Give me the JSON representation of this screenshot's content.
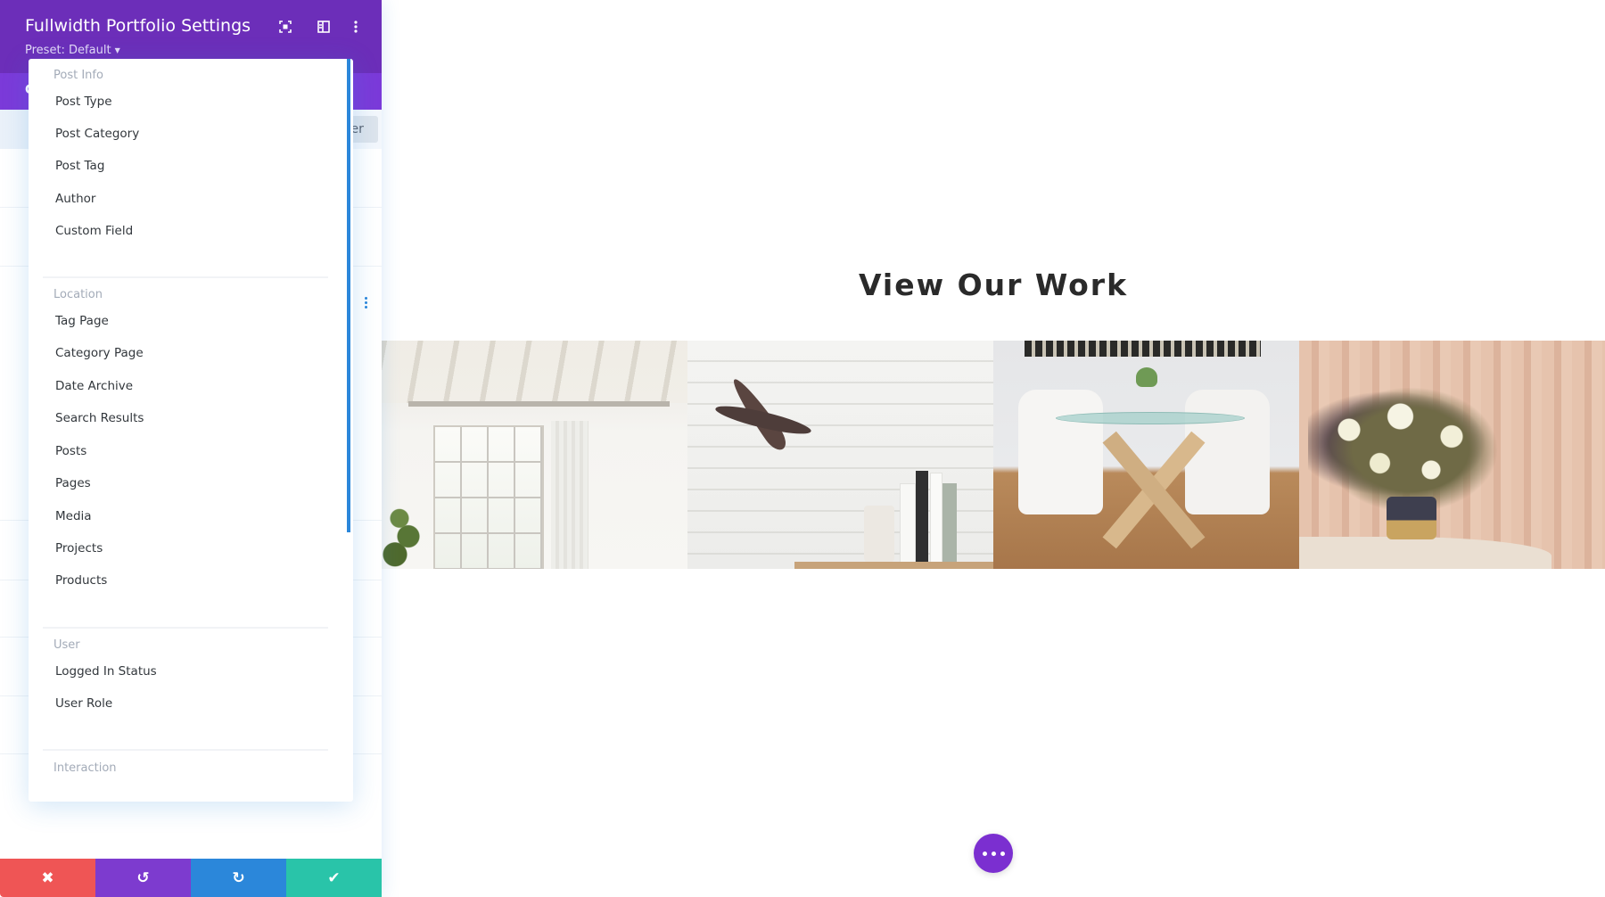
{
  "panel": {
    "title": "Fullwidth Portfolio Settings",
    "preset_label": "Preset: Default",
    "header_icons": [
      "expand-icon",
      "layout-icon",
      "more-vertical-icon"
    ],
    "tab_partial": "C",
    "filter_partial": "ter"
  },
  "dropdown": {
    "groups": [
      {
        "label": "Post Info",
        "items": [
          "Post Type",
          "Post Category",
          "Post Tag",
          "Author",
          "Custom Field"
        ]
      },
      {
        "label": "Location",
        "items": [
          "Tag Page",
          "Category Page",
          "Date Archive",
          "Search Results",
          "Posts",
          "Pages",
          "Media",
          "Projects",
          "Products"
        ]
      },
      {
        "label": "User",
        "items": [
          "Logged In Status",
          "User Role"
        ]
      },
      {
        "label": "Interaction",
        "items": []
      }
    ]
  },
  "bottom_bar": {
    "buttons": [
      {
        "name": "discard",
        "icon": "close-icon",
        "glyph": "✖",
        "color": "#ef5555"
      },
      {
        "name": "undo",
        "icon": "undo-icon",
        "glyph": "↺",
        "color": "#7d3bcf"
      },
      {
        "name": "redo",
        "icon": "redo-icon",
        "glyph": "↻",
        "color": "#2b87da"
      },
      {
        "name": "save",
        "icon": "check-icon",
        "glyph": "✔",
        "color": "#29c4a9"
      }
    ]
  },
  "canvas": {
    "section_title": "View Our Work",
    "gallery": [
      {
        "alt": "Bright loft interior with tall windows"
      },
      {
        "alt": "Plant in vase beside books on shelf"
      },
      {
        "alt": "Glass dining table with white chairs"
      },
      {
        "alt": "Flower arrangement in ceramic pot"
      }
    ]
  },
  "colors": {
    "header_purple": "#6c2eb9",
    "tab_purple": "#7b3ad9",
    "accent_blue": "#2b87da",
    "fab_purple": "#7b2fd0"
  }
}
